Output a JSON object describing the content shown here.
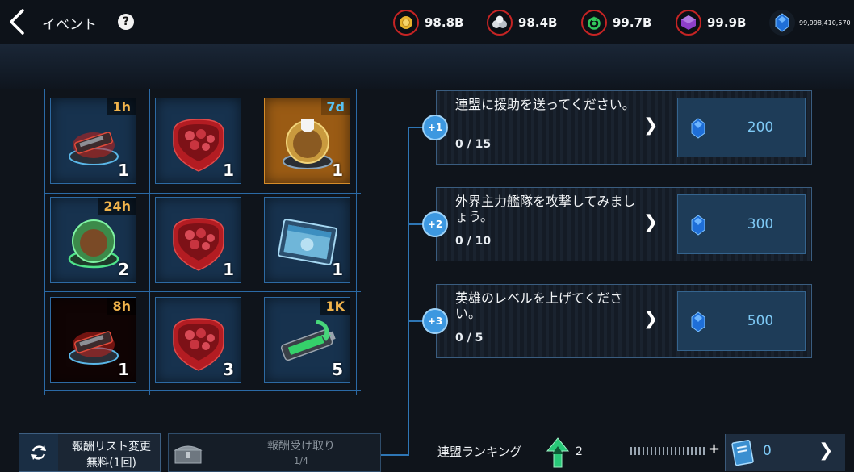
{
  "header": {
    "title": "イベント",
    "help_label": "?",
    "resources": [
      {
        "icon": "gold-coin-icon",
        "value": "98.8B",
        "color": "#e7b32e"
      },
      {
        "icon": "ore-icon",
        "value": "98.4B",
        "color": "#d9dde1"
      },
      {
        "icon": "gas-icon",
        "value": "99.7B",
        "color": "#33c85c"
      },
      {
        "icon": "crystal-icon",
        "value": "99.9B",
        "color": "#a05ad8"
      },
      {
        "icon": "blue-gem-icon",
        "value": "99,998,410,570",
        "color": "#2f8df0"
      }
    ]
  },
  "rewards": [
    {
      "name": "warship-blueprint",
      "tag": "1h",
      "qty": "1"
    },
    {
      "name": "red-gem-chest",
      "tag": "",
      "qty": "1"
    },
    {
      "name": "shield-booster",
      "tag": "7d",
      "qty": "1"
    },
    {
      "name": "green-dome-booster",
      "tag": "24h",
      "qty": "2"
    },
    {
      "name": "red-gem-chest",
      "tag": "",
      "qty": "1"
    },
    {
      "name": "applicant-card",
      "tag": "",
      "qty": "1"
    },
    {
      "name": "warship-blueprint",
      "tag": "8h",
      "qty": "1"
    },
    {
      "name": "red-gem-chest",
      "tag": "",
      "qty": "3"
    },
    {
      "name": "exp-battery",
      "tag": "1K",
      "qty": "5"
    }
  ],
  "missions": [
    {
      "step": "+1",
      "text": "連盟に援助を送ってください。",
      "progress": "0 / 15",
      "reward": "200"
    },
    {
      "step": "+2",
      "text": "外界主力艦隊を攻撃してみましょう。",
      "progress": "0 / 10",
      "reward": "300"
    },
    {
      "step": "+3",
      "text": "英雄のレベルを上げてください。",
      "progress": "0 / 5",
      "reward": "500"
    }
  ],
  "bottom": {
    "refresh_line1": "報酬リスト変更",
    "refresh_line2": "無料(1回)",
    "claim_line1": "報酬受け取り",
    "claim_line2": "1/4",
    "ranking_label": "連盟ランキング",
    "ranking_value": "2",
    "plus": "+",
    "tickets": "0"
  }
}
